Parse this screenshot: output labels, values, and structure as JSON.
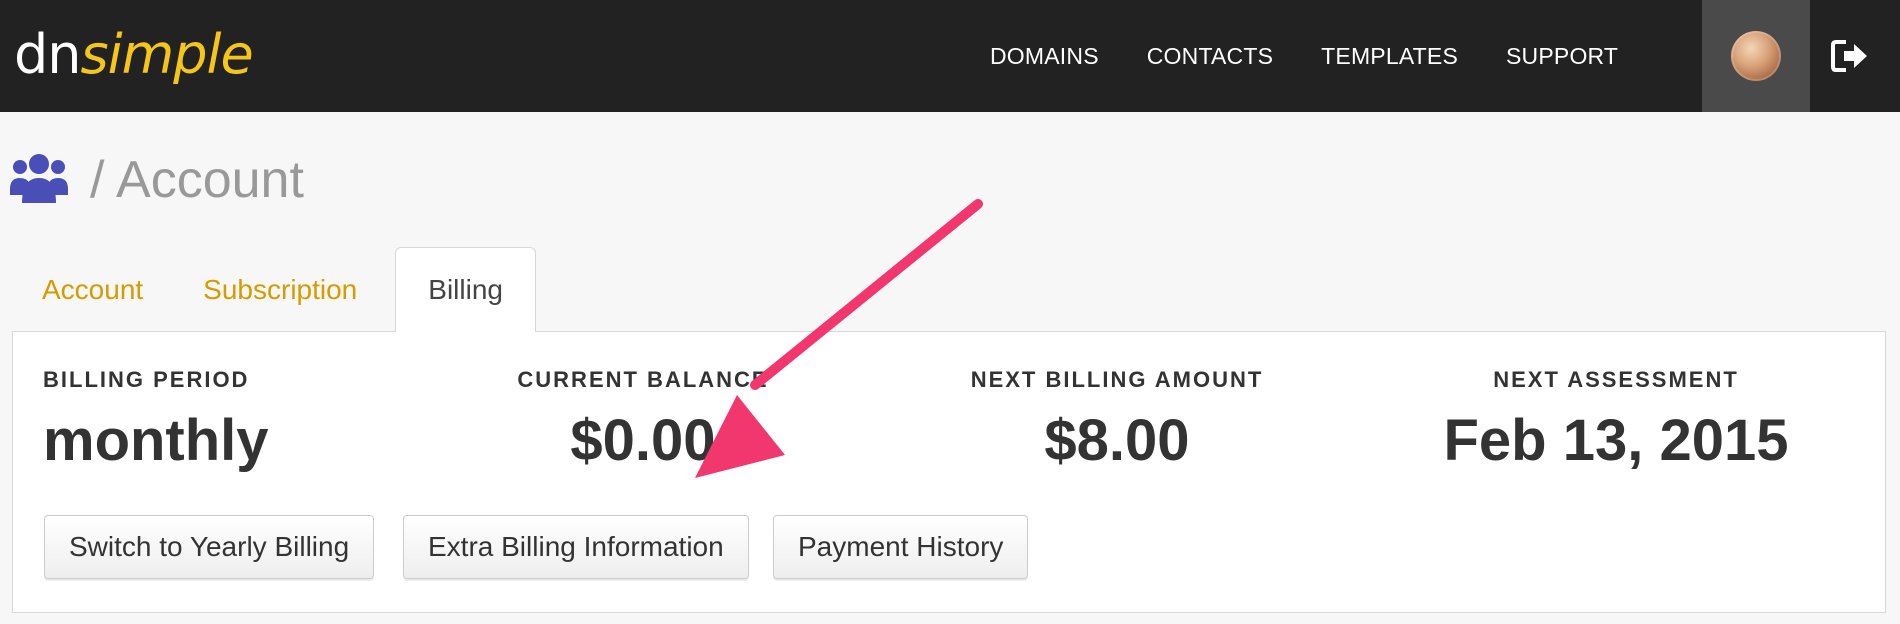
{
  "brand": {
    "logo_dn": "dn",
    "logo_simple": "simple"
  },
  "nav": {
    "links": [
      "DOMAINS",
      "CONTACTS",
      "TEMPLATES",
      "SUPPORT"
    ]
  },
  "page": {
    "title": "/ Account"
  },
  "tabs": [
    {
      "label": "Account",
      "active": false
    },
    {
      "label": "Subscription",
      "active": false
    },
    {
      "label": "Billing",
      "active": true
    }
  ],
  "billing": {
    "stats": [
      {
        "label": "BILLING PERIOD",
        "value": "monthly"
      },
      {
        "label": "CURRENT BALANCE",
        "value": "$0.00"
      },
      {
        "label": "NEXT BILLING AMOUNT",
        "value": "$8.00"
      },
      {
        "label": "NEXT ASSESSMENT",
        "value": "Feb 13, 2015"
      }
    ],
    "buttons": [
      "Switch to Yearly Billing",
      "Extra Billing Information",
      "Payment History"
    ]
  },
  "colors": {
    "navbar": "#222222",
    "logo_accent": "#f5c518",
    "tab_link": "#d69b00",
    "users_icon": "#4a4fb8",
    "annotation_arrow": "#f2366e"
  },
  "icons": {
    "users": "users-icon",
    "logout": "logout-icon",
    "avatar": "avatar"
  }
}
